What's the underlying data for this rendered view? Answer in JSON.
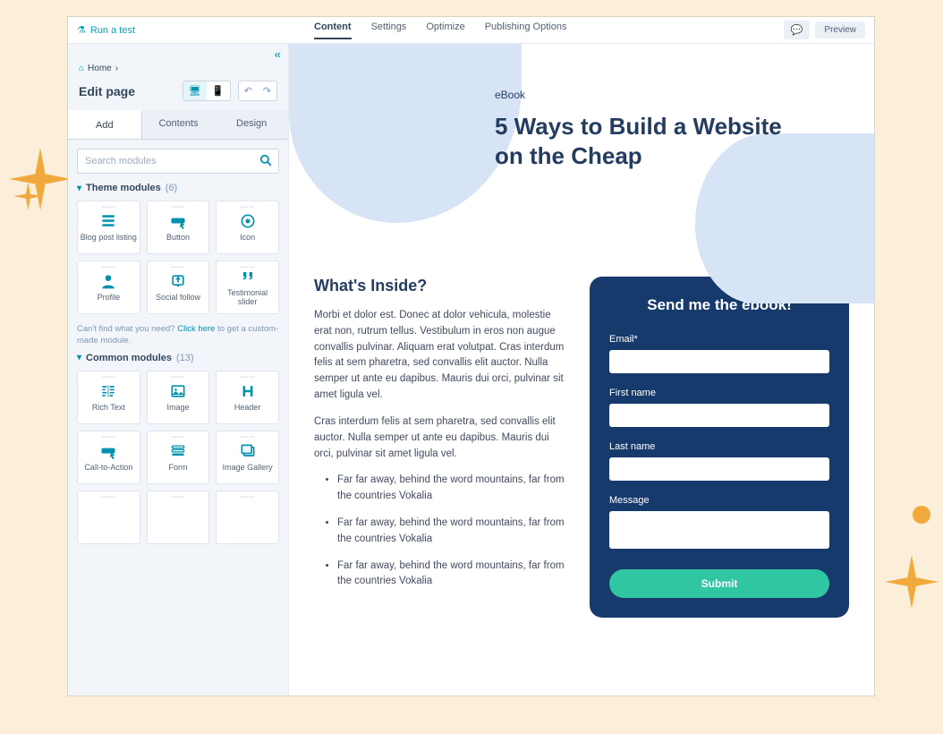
{
  "topbar": {
    "run_test": "Run a test",
    "tabs": [
      "Content",
      "Settings",
      "Optimize",
      "Publishing Options"
    ],
    "preview": "Preview"
  },
  "sidebar": {
    "home": "Home",
    "title": "Edit page",
    "tabs": [
      "Add",
      "Contents",
      "Design"
    ],
    "search_placeholder": "Search modules",
    "theme_header": "Theme modules",
    "theme_count": "(6)",
    "theme_modules": [
      "Blog post listing",
      "Button",
      "Icon",
      "Profile",
      "Social follow",
      "Testimonial slider"
    ],
    "hint_pre": "Can't find what you need? ",
    "hint_link": "Click here",
    "hint_post": " to get a custom-made module.",
    "common_header": "Common modules",
    "common_count": "(13)",
    "common_modules": [
      "Rich Text",
      "Image",
      "Header",
      "Call-to-Action",
      "Form",
      "Image Gallery"
    ]
  },
  "canvas": {
    "eyebrow": "eBook",
    "hero_title": "5 Ways to Build a Website on the Cheap",
    "article_heading": "What's Inside?",
    "para1": "Morbi et dolor est. Donec at dolor vehicula, molestie erat non, rutrum tellus. Vestibulum in eros non augue convallis pulvinar. Aliquam erat volutpat. Cras interdum felis at sem pharetra, sed convallis elit auctor. Nulla semper ut ante eu dapibus. Mauris dui orci, pulvinar sit amet ligula vel.",
    "para2": "Cras interdum felis at sem pharetra, sed convallis elit auctor. Nulla semper ut ante eu dapibus. Mauris dui orci, pulvinar sit amet ligula vel.",
    "bullets": [
      "Far far away, behind the word mountains, far from the countries Vokalia",
      "Far far away, behind the word mountains, far from the countries Vokalia",
      "Far far away, behind the word mountains, far from the countries Vokalia"
    ],
    "form": {
      "title": "Send me the ebook!",
      "email_label": "Email*",
      "first_label": "First name",
      "last_label": "Last name",
      "message_label": "Message",
      "submit": "Submit"
    }
  }
}
